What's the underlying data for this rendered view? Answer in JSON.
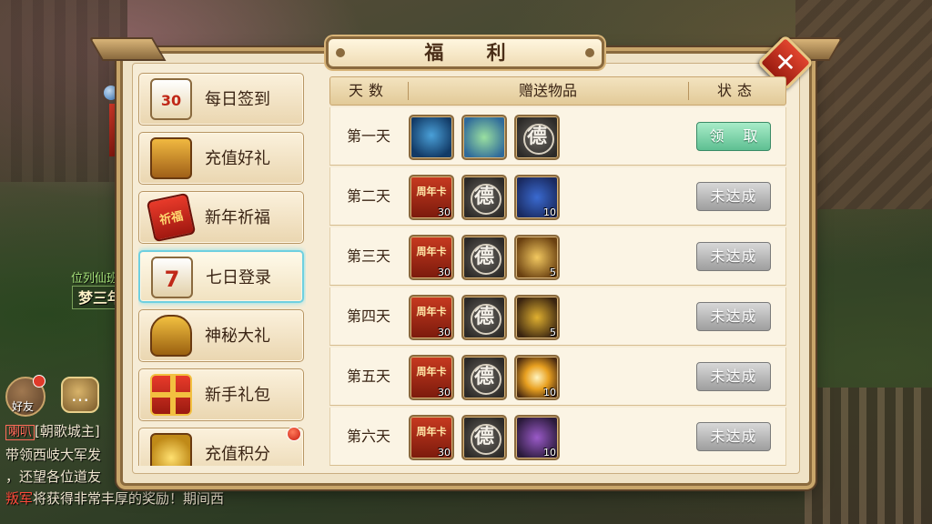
{
  "window": {
    "title": "福 利",
    "close_glyph": "✕"
  },
  "hud": {
    "player_title": "位列仙班",
    "player_name": "梦三年源码",
    "friend_label": "好友",
    "chat_glyph": "…",
    "chat_tag": "喇叭",
    "chat_lines": [
      "[朝歌城主]",
      "带领西岐大军发",
      "，还望各位道友",
      "叛军",
      "将获得非常丰厚的奖励！期间西"
    ]
  },
  "menu": {
    "items": [
      {
        "label": "每日签到",
        "icon": "calendar-30-icon",
        "glyph": "30"
      },
      {
        "label": "充值好礼",
        "icon": "treasure-chest-icon",
        "glyph": ""
      },
      {
        "label": "新年祈福",
        "icon": "red-envelope-icon",
        "glyph": "祈福"
      },
      {
        "label": "七日登录",
        "icon": "calendar-7-icon",
        "glyph": "7",
        "active": true
      },
      {
        "label": "神秘大礼",
        "icon": "golden-vase-icon",
        "glyph": ""
      },
      {
        "label": "新手礼包",
        "icon": "gift-box-icon",
        "glyph": ""
      },
      {
        "label": "充值积分",
        "icon": "gold-pile-icon",
        "glyph": "",
        "badge": true
      }
    ]
  },
  "table": {
    "headers": {
      "day": "天数",
      "gifts": "赠送物品",
      "state": "状态"
    },
    "rows": [
      {
        "day": "第一天",
        "items": [
          {
            "icon": "blue-dragon-icon",
            "qty": ""
          },
          {
            "icon": "jade-pet-icon",
            "qty": ""
          },
          {
            "icon": "virtue-coin-icon",
            "glyph": "德",
            "qty": ""
          }
        ],
        "state": "领 取",
        "claimable": true
      },
      {
        "day": "第二天",
        "items": [
          {
            "icon": "anniversary-card-icon",
            "glyph": "周年卡",
            "qty": "30"
          },
          {
            "icon": "virtue-coin-icon",
            "glyph": "德",
            "qty": ""
          },
          {
            "icon": "blue-scroll-icon",
            "qty": "10"
          }
        ],
        "state": "未达成",
        "claimable": false
      },
      {
        "day": "第三天",
        "items": [
          {
            "icon": "anniversary-card-icon",
            "glyph": "周年卡",
            "qty": "30"
          },
          {
            "icon": "virtue-coin-icon",
            "glyph": "德",
            "qty": ""
          },
          {
            "icon": "treasure-map-icon",
            "qty": "5"
          }
        ],
        "state": "未达成",
        "claimable": false
      },
      {
        "day": "第四天",
        "items": [
          {
            "icon": "anniversary-card-icon",
            "glyph": "周年卡",
            "qty": "30"
          },
          {
            "icon": "virtue-coin-icon",
            "glyph": "德",
            "qty": ""
          },
          {
            "icon": "gold-ring-icon",
            "qty": "5"
          }
        ],
        "state": "未达成",
        "claimable": false
      },
      {
        "day": "第五天",
        "items": [
          {
            "icon": "anniversary-card-icon",
            "glyph": "周年卡",
            "qty": "30"
          },
          {
            "icon": "virtue-coin-icon",
            "glyph": "德",
            "qty": ""
          },
          {
            "icon": "golden-spark-icon",
            "qty": "10"
          }
        ],
        "state": "未达成",
        "claimable": false
      },
      {
        "day": "第六天",
        "items": [
          {
            "icon": "anniversary-card-icon",
            "glyph": "周年卡",
            "qty": "30"
          },
          {
            "icon": "virtue-coin-icon",
            "glyph": "德",
            "qty": ""
          },
          {
            "icon": "purple-stone-icon",
            "qty": "10"
          }
        ],
        "state": "未达成",
        "claimable": false
      }
    ]
  }
}
